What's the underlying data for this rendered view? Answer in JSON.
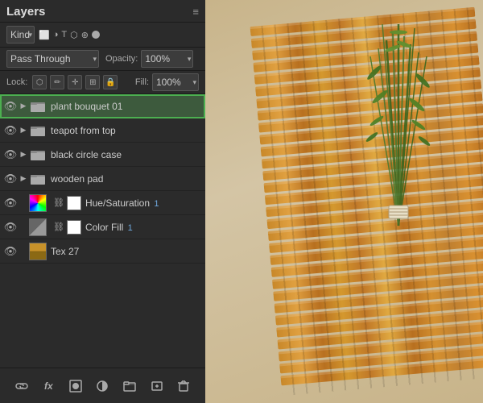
{
  "panel": {
    "title": "Layers",
    "menu_icon": "≡",
    "kind_label": "Kind",
    "kind_options": [
      "Kind"
    ],
    "blend_mode": "Pass Through",
    "opacity_label": "Opacity:",
    "opacity_value": "100%",
    "lock_label": "Lock:",
    "fill_label": "Fill:",
    "fill_value": "100%",
    "layers": [
      {
        "id": "layer-1",
        "name": "plant bouquet 01",
        "type": "group",
        "visible": true,
        "selected": true,
        "has_children": true
      },
      {
        "id": "layer-2",
        "name": "teapot from top",
        "type": "group",
        "visible": true,
        "selected": false,
        "has_children": true
      },
      {
        "id": "layer-3",
        "name": "black circle case",
        "type": "group",
        "visible": true,
        "selected": false,
        "has_children": true
      },
      {
        "id": "layer-4",
        "name": "wooden pad",
        "type": "group",
        "visible": true,
        "selected": false,
        "has_children": true
      },
      {
        "id": "layer-5",
        "name": "Hue/Saturation 1",
        "type": "adjustment",
        "adj_type": "hue-sat",
        "visible": true,
        "selected": false,
        "has_children": false,
        "has_chain": true,
        "has_mask": true
      },
      {
        "id": "layer-6",
        "name": "Color Fill 1",
        "type": "fill",
        "adj_type": "color-fill",
        "visible": true,
        "selected": false,
        "has_children": false,
        "has_chain": true,
        "has_mask": true
      },
      {
        "id": "layer-7",
        "name": "Tex 27",
        "type": "raster",
        "visible": true,
        "selected": false,
        "has_children": false
      }
    ],
    "bottom_tools": [
      {
        "id": "link",
        "icon": "🔗",
        "label": "link-layers-button"
      },
      {
        "id": "fx",
        "icon": "fx",
        "label": "add-effect-button"
      },
      {
        "id": "mask",
        "icon": "⬜",
        "label": "add-mask-button"
      },
      {
        "id": "adjustment",
        "icon": "◑",
        "label": "add-adjustment-button"
      },
      {
        "id": "group",
        "icon": "📁",
        "label": "new-group-button"
      },
      {
        "id": "new",
        "icon": "🗋",
        "label": "new-layer-button"
      },
      {
        "id": "delete",
        "icon": "🗑",
        "label": "delete-layer-button"
      }
    ]
  }
}
